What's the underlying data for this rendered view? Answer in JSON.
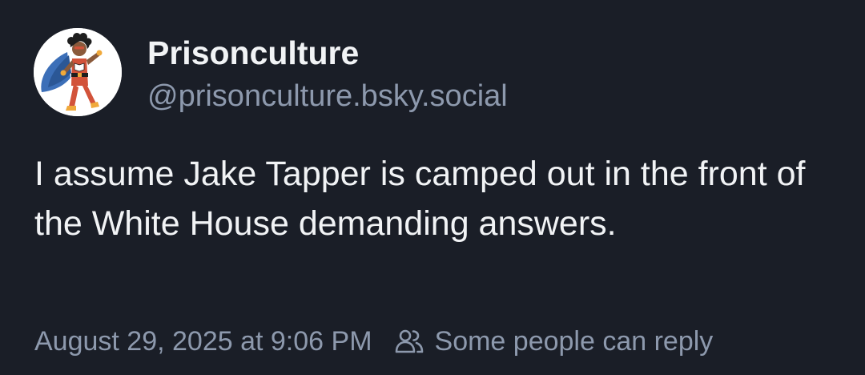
{
  "author": {
    "display_name": "Prisonculture",
    "handle": "@prisonculture.bsky.social",
    "avatar_icon": "superhero-illustration-avatar"
  },
  "post": {
    "text": "I assume Jake Tapper is camped out in the front of the White House demanding answers."
  },
  "meta": {
    "timestamp": "August 29, 2025 at 9:06 PM",
    "reply_setting_icon": "people-icon",
    "reply_setting_label": "Some people can reply"
  },
  "colors": {
    "background": "#1a1e27",
    "primary_text": "#f1f3f5",
    "secondary_text": "#8d99ad"
  }
}
